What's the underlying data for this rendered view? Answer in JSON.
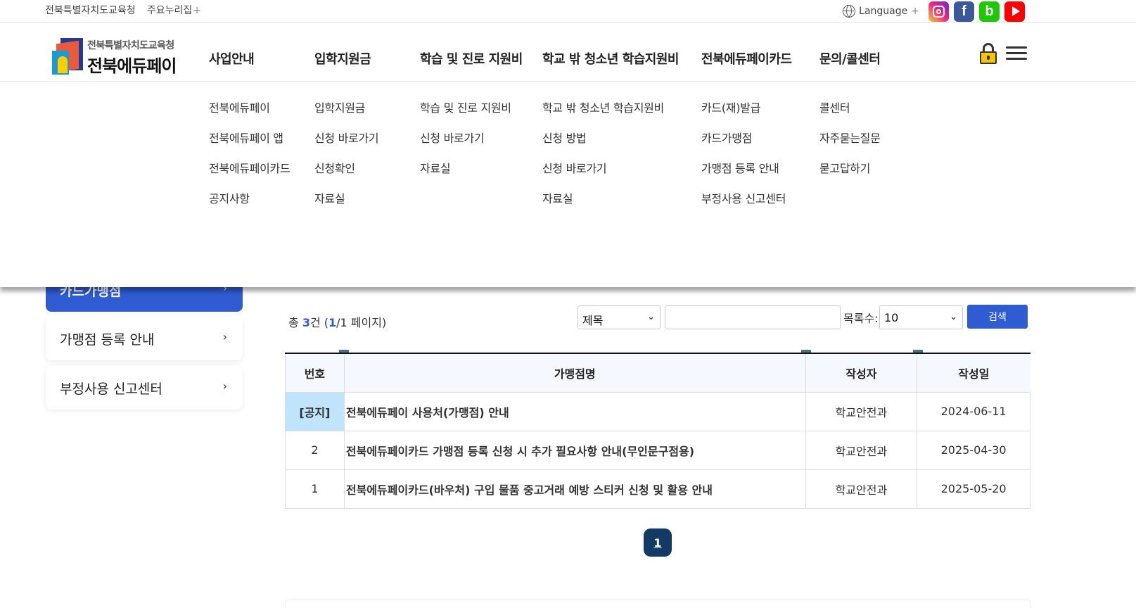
{
  "utility": {
    "links": [
      "전북특별자치도교육청",
      "주요누리집"
    ],
    "plus": "+",
    "language": "Language",
    "sns": [
      "instagram-icon",
      "facebook-icon",
      "blog-icon",
      "youtube-icon"
    ],
    "fb_letter": "f",
    "blog_letter": "b"
  },
  "logo": {
    "sub": "전북특별자치도교육청",
    "main": "전북에듀페이"
  },
  "gnb": [
    "사업안내",
    "입학지원금",
    "학습 및 진로 지원비",
    "학교 밖 청소년 학습지원비",
    "전북에듀페이카드",
    "문의/콜센터"
  ],
  "mega": [
    [
      "전북에듀페이",
      "전북에듀페이 앱",
      "전북에듀페이카드",
      "공지사항"
    ],
    [
      "입학지원금",
      "신청 바로가기",
      "신청확인",
      "자료실"
    ],
    [
      "학습 및 진로 지원비",
      "신청 바로가기",
      "자료실"
    ],
    [
      "학교 밖 청소년 학습지원비",
      "신청 방법",
      "신청 바로가기",
      "자료실"
    ],
    [
      "카드(재)발급",
      "카드가맹점",
      "가맹점 등록 안내",
      "부정사용 신고센터"
    ],
    [
      "콜센터",
      "자주묻는질문",
      "묻고답하기"
    ]
  ],
  "sidebar": {
    "active": "카드가맹점",
    "items": [
      "가맹점 등록 안내",
      "부정사용 신고센터"
    ],
    "chevron": "›"
  },
  "board": {
    "total_prefix": "총 ",
    "total_count": "3",
    "total_mid": "건 (",
    "page_current": "1",
    "page_suffix": "/1 페이지)",
    "search_field": "제목",
    "search_value": "",
    "count_label": "목록수:",
    "count_value": "10",
    "search_button": "검색",
    "select_arrow": "⌄",
    "columns": [
      "번호",
      "가맹점명",
      "작성자",
      "작성일"
    ],
    "rows": [
      {
        "no": "[공지]",
        "title": "전북에듀페이 사용처(가맹점) 안내",
        "author": "학교안전과",
        "date": "2024-06-11"
      },
      {
        "no": "2",
        "title": "전북에듀페이카드 가맹점 등록 신청 시 추가 필요사항 안내(무인문구점용)",
        "author": "학교안전과",
        "date": "2025-04-30"
      },
      {
        "no": "1",
        "title": "전북에듀페이카드(바우처) 구입 물품 중고거래 예방 스티커 신청 및 활용 안내",
        "author": "학교안전과",
        "date": "2025-05-20"
      }
    ],
    "pages": [
      "1"
    ]
  },
  "colors": {
    "primary": "#2f5bd3",
    "pager": "#123a64",
    "notice_bg": "#bfe4fb"
  }
}
